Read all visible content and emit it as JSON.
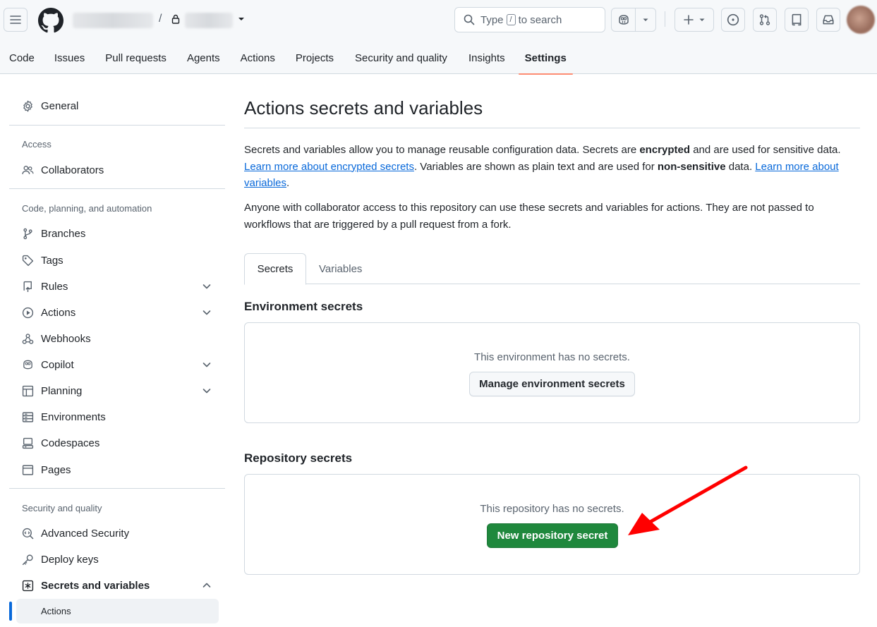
{
  "header": {
    "search_prefix": "Type",
    "search_key": "/",
    "search_suffix": "to search",
    "repo_separator": "/"
  },
  "tabs": [
    {
      "label": "Code"
    },
    {
      "label": "Issues"
    },
    {
      "label": "Pull requests"
    },
    {
      "label": "Agents"
    },
    {
      "label": "Actions"
    },
    {
      "label": "Projects"
    },
    {
      "label": "Security and quality"
    },
    {
      "label": "Insights"
    },
    {
      "label": "Settings",
      "active": true
    }
  ],
  "sidebar": {
    "general": "General",
    "access_heading": "Access",
    "collaborators": "Collaborators",
    "code_heading": "Code, planning, and automation",
    "branches": "Branches",
    "tags": "Tags",
    "rules": "Rules",
    "actions": "Actions",
    "webhooks": "Webhooks",
    "copilot": "Copilot",
    "planning": "Planning",
    "environments": "Environments",
    "codespaces": "Codespaces",
    "pages": "Pages",
    "security_heading": "Security and quality",
    "advanced_security": "Advanced Security",
    "deploy_keys": "Deploy keys",
    "secrets_and_variables": "Secrets and variables",
    "secrets_actions": "Actions"
  },
  "main": {
    "title": "Actions secrets and variables",
    "intro_1": "Secrets and variables allow you to manage reusable configuration data. Secrets are ",
    "intro_encrypted": "encrypted",
    "intro_2": " and are used for sensitive data. ",
    "link_secrets": "Learn more about encrypted secrets",
    "intro_3": ". Variables are shown as plain text and are used for ",
    "intro_nonsensitive": "non-sensitive",
    "intro_4": " data. ",
    "link_variables": "Learn more about variables",
    "intro_5": ".",
    "access_note": "Anyone with collaborator access to this repository can use these secrets and variables for actions. They are not passed to workflows that are triggered by a pull request from a fork.",
    "tab_secrets": "Secrets",
    "tab_variables": "Variables",
    "env_heading": "Environment secrets",
    "env_empty": "This environment has no secrets.",
    "env_button": "Manage environment secrets",
    "repo_heading": "Repository secrets",
    "repo_empty": "This repository has no secrets.",
    "repo_button": "New repository secret"
  },
  "colors": {
    "primary_button": "#1f883d",
    "link": "#0969da",
    "active_tab_underline": "#fd8c73",
    "annotation_arrow": "#ff0000"
  }
}
